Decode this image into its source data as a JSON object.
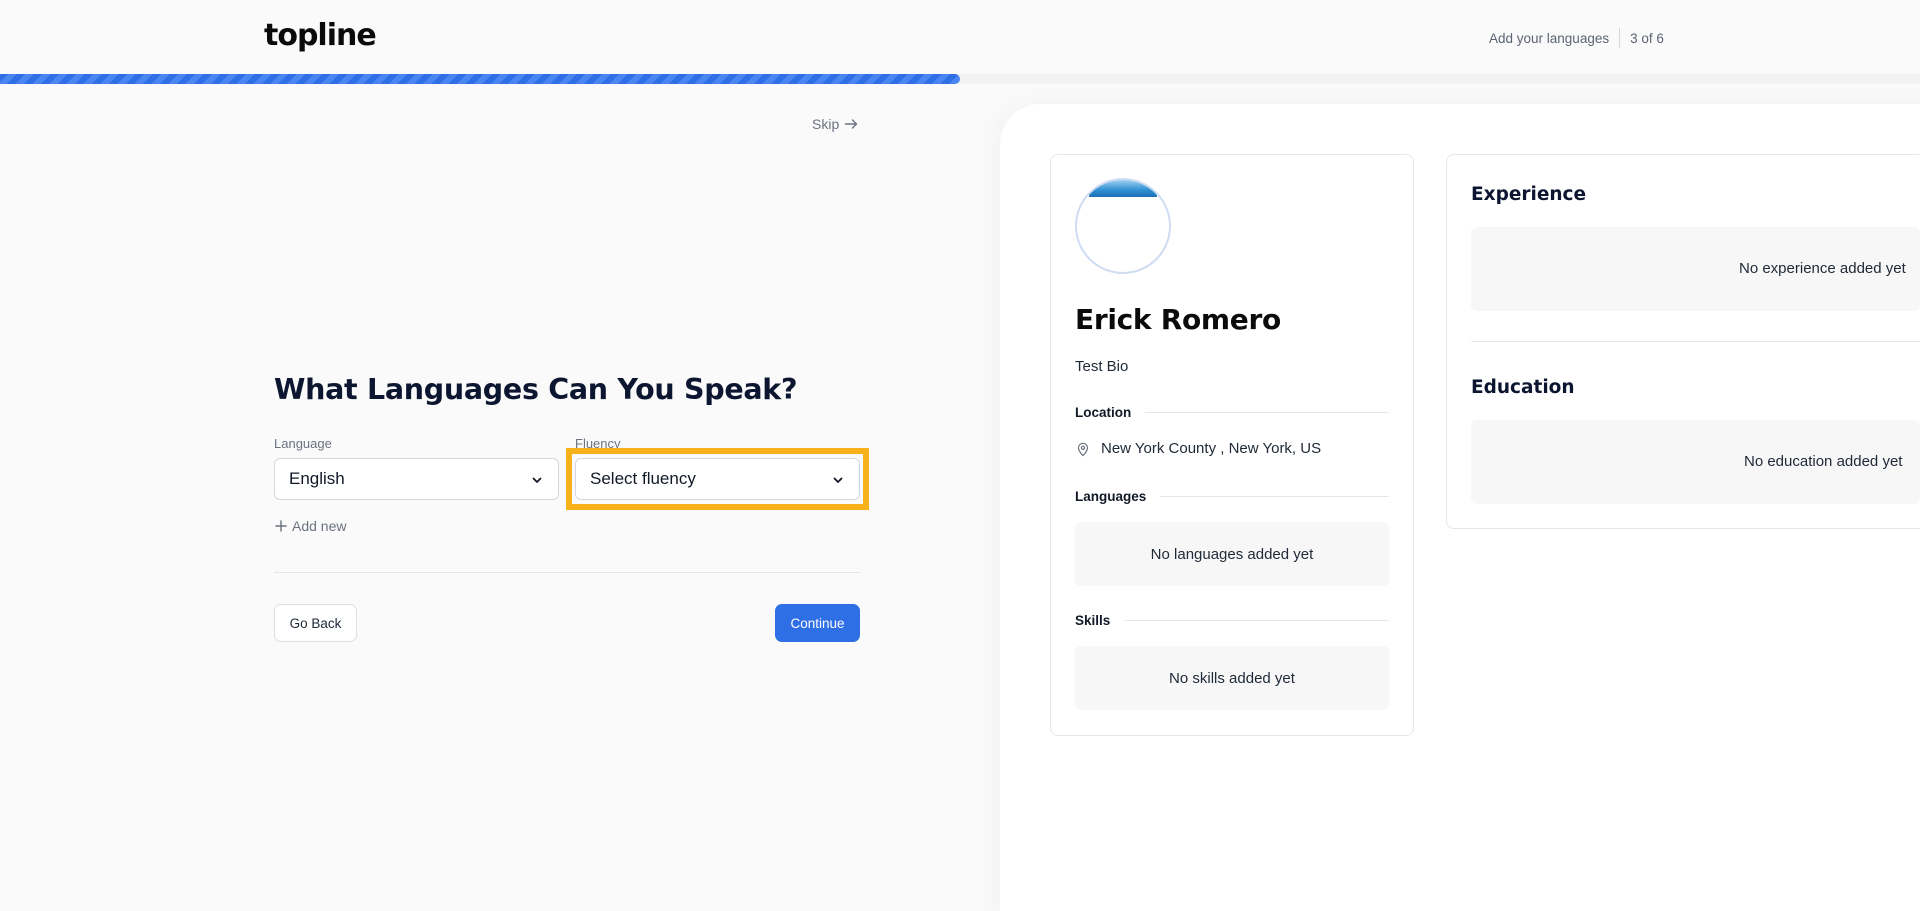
{
  "header": {
    "logo": "topline",
    "step_label": "Add your languages",
    "step_count": "3 of 6",
    "progress": 0.5
  },
  "form": {
    "skip_label": "Skip",
    "title": "What Languages Can You Speak?",
    "language_label": "Language",
    "language_value": "English",
    "fluency_label": "Fluency",
    "fluency_placeholder": "Select fluency",
    "add_new_label": "Add new",
    "back_label": "Go Back",
    "continue_label": "Continue"
  },
  "profile": {
    "name": "Erick Romero",
    "bio": "Test Bio",
    "location_heading": "Location",
    "location_value": "New York County , New York, US",
    "languages_heading": "Languages",
    "languages_empty": "No languages added yet",
    "skills_heading": "Skills",
    "skills_empty": "No skills added yet"
  },
  "sidebar": {
    "experience_heading": "Experience",
    "experience_empty": "No experience added yet",
    "education_heading": "Education",
    "education_empty": "No education added yet"
  },
  "colors": {
    "accent": "#2f6fe6",
    "highlight": "#f7b21b"
  }
}
